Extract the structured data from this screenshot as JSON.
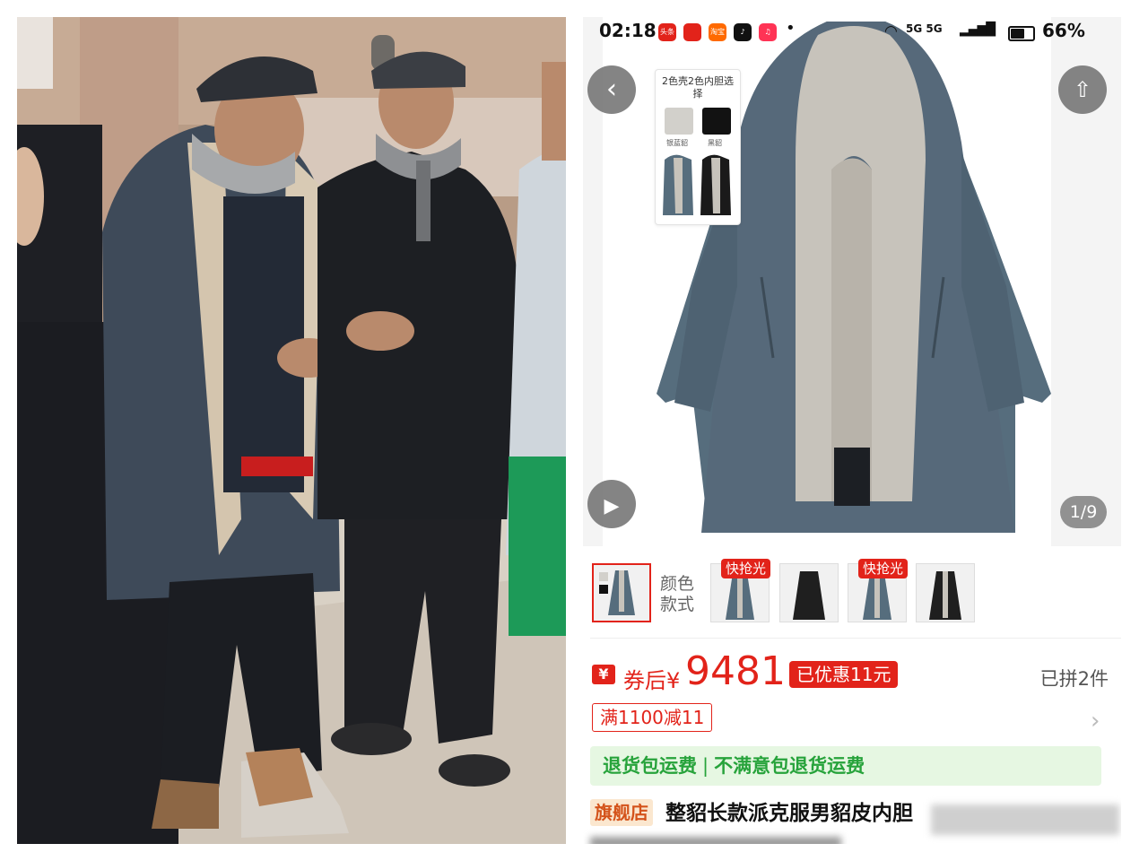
{
  "status_bar": {
    "time": "02:18",
    "app_icons": [
      {
        "name": "toutiao-app-icon",
        "label": "头条",
        "color": "#e2231a"
      },
      {
        "name": "pinduoduo-app-icon",
        "label": "",
        "color": "#e2231a"
      },
      {
        "name": "taobao-app-icon",
        "label": "淘宝",
        "color": "#ff6a00"
      },
      {
        "name": "douyin-app-icon",
        "label": "",
        "color": "#111111"
      },
      {
        "name": "music-app-icon",
        "label": "",
        "color": "#ff3355"
      }
    ],
    "network": "5G 5G",
    "battery": "66%",
    "battery_level": 0.66
  },
  "gallery": {
    "swatch_card": {
      "title": "2色壳2色内胆选择",
      "options": [
        "银蓝貂",
        "黑貂"
      ]
    },
    "page_counter": "1/9"
  },
  "thumbnails": {
    "label": "颜色款式",
    "items": [
      {
        "tag": "",
        "color": "#566d7d",
        "selected": true
      },
      {
        "tag": "快抢光",
        "color": "#566d7d",
        "selected": false
      },
      {
        "tag": "",
        "color": "#1f1f1f",
        "selected": false
      },
      {
        "tag": "快抢光",
        "color": "#566d7d",
        "selected": false
      },
      {
        "tag": "",
        "color": "#1f1f1f",
        "selected": false
      }
    ]
  },
  "price": {
    "badge": "¥",
    "prefix": "券后¥",
    "value": "9481",
    "discount": "已优惠11元",
    "sold": "已拼2件"
  },
  "coupon": "满1100减11",
  "guarantee": {
    "left": "退货包运费",
    "separator": "|",
    "right": "不满意包退货运费"
  },
  "product": {
    "store_tag": "旗舰店",
    "title": "整貂长款派克服男貂皮内胆"
  },
  "colors": {
    "accent": "#e2231a",
    "guarantee_green": "#27a33b",
    "coat_blue": "#566d7d"
  }
}
